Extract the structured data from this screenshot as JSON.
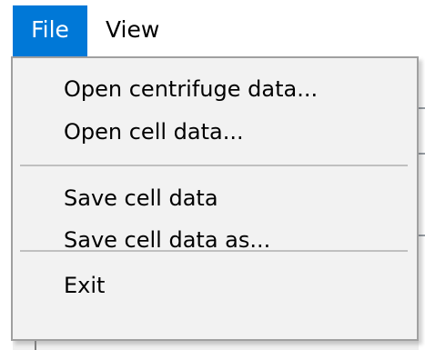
{
  "menubar": {
    "items": [
      {
        "label": "File",
        "active": true
      },
      {
        "label": "View",
        "active": false
      }
    ]
  },
  "file_menu": {
    "items": [
      {
        "label": "Open centrifuge data..."
      },
      {
        "label": "Open cell data..."
      },
      {
        "label": "Save cell data"
      },
      {
        "label": "Save cell data as..."
      },
      {
        "label": "Exit"
      }
    ]
  },
  "colors": {
    "menubar_active_bg": "#0078d7",
    "menubar_active_text": "#ffffff",
    "dropdown_bg": "#f2f2f2",
    "dropdown_border": "#a0a0a0",
    "separator": "#c0c0c0"
  }
}
